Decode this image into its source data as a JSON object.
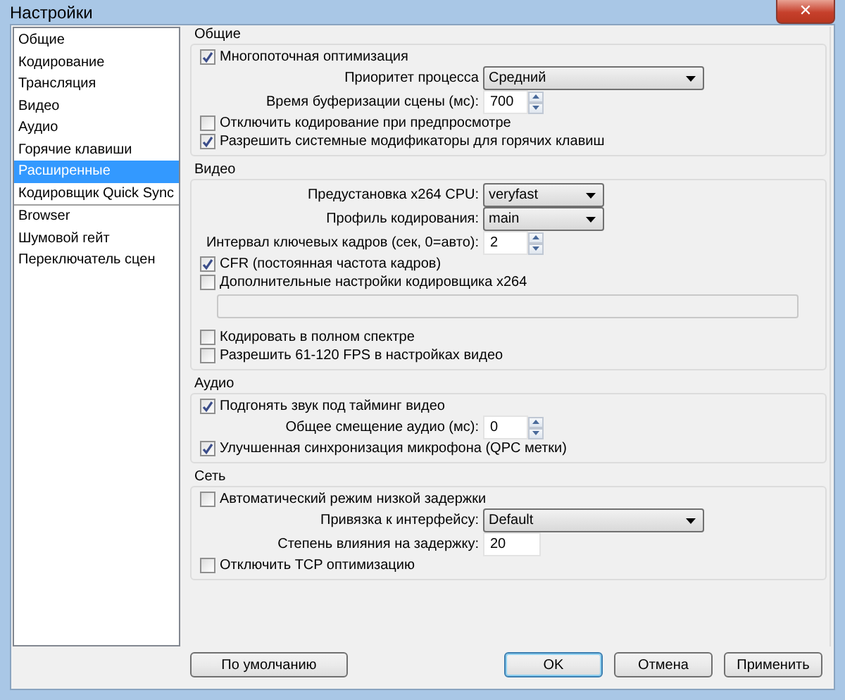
{
  "window": {
    "title": "Настройки",
    "close": "✕"
  },
  "sidebar": {
    "groups": [
      {
        "items": [
          {
            "label": "Общие",
            "selected": false
          },
          {
            "label": "Кодирование",
            "selected": false
          },
          {
            "label": "Трансляция",
            "selected": false
          },
          {
            "label": "Видео",
            "selected": false
          },
          {
            "label": "Аудио",
            "selected": false
          },
          {
            "label": "Горячие клавиши",
            "selected": false
          },
          {
            "label": "Расширенные",
            "selected": true
          },
          {
            "label": "Кодировщик Quick Sync",
            "selected": false
          }
        ]
      },
      {
        "items": [
          {
            "label": "Browser",
            "selected": false
          },
          {
            "label": "Шумовой гейт",
            "selected": false
          },
          {
            "label": "Переключатель сцен",
            "selected": false
          }
        ]
      }
    ]
  },
  "sections": [
    {
      "title": "Общие",
      "rows": [
        {
          "kind": "checkbox",
          "label": "Многопоточная оптимизация",
          "checked": true
        },
        {
          "kind": "select",
          "label": "Приоритет процесса",
          "value": "Средний",
          "wide": true
        },
        {
          "kind": "spin",
          "label": "Время буферизации сцены (мс):",
          "value": "700"
        },
        {
          "kind": "checkbox",
          "label": "Отключить кодирование при предпросмотре",
          "checked": false
        },
        {
          "kind": "checkbox",
          "label": "Разрешить системные модификаторы для горячих клавиш",
          "checked": true
        }
      ]
    },
    {
      "title": "Видео",
      "rows": [
        {
          "kind": "select",
          "label": "Предустановка x264 CPU:",
          "value": "veryfast",
          "wide": false
        },
        {
          "kind": "select",
          "label": "Профиль кодирования:",
          "value": "main",
          "wide": false
        },
        {
          "kind": "spin",
          "label": "Интервал ключевых кадров (сек, 0=авто):",
          "value": "2"
        },
        {
          "kind": "checkbox",
          "label": "CFR (постоянная частота кадров)",
          "checked": true
        },
        {
          "kind": "checkbox",
          "label": "Дополнительные настройки кодировщика x264",
          "checked": false
        },
        {
          "kind": "textbox"
        },
        {
          "kind": "checkbox",
          "label": "Кодировать в полном спектре",
          "checked": false
        },
        {
          "kind": "checkbox",
          "label": "Разрешить 61-120 FPS в настройках видео",
          "checked": false
        }
      ]
    },
    {
      "title": "Аудио",
      "rows": [
        {
          "kind": "checkbox",
          "label": "Подгонять звук под тайминг видео",
          "checked": true
        },
        {
          "kind": "spin",
          "label": "Общее смещение аудио (мс):",
          "value": "0"
        },
        {
          "kind": "checkbox",
          "label": "Улучшенная синхронизация микрофона (QPC метки)",
          "checked": true
        }
      ]
    },
    {
      "title": "Сеть",
      "rows": [
        {
          "kind": "checkbox",
          "label": "Автоматический режим низкой задержки",
          "checked": false
        },
        {
          "kind": "select",
          "label": "Привязка к интерфейсу:",
          "value": "Default",
          "wide": true
        },
        {
          "kind": "text",
          "label": "Степень влияния на задержку:",
          "value": "20"
        },
        {
          "kind": "checkbox",
          "label": "Отключить TCP оптимизацию",
          "checked": false
        }
      ]
    }
  ],
  "buttons": {
    "defaults": "По умолчанию",
    "actions": [
      {
        "label": "OK",
        "default": true
      },
      {
        "label": "Отмена",
        "default": false
      },
      {
        "label": "Применить",
        "default": false
      }
    ]
  }
}
